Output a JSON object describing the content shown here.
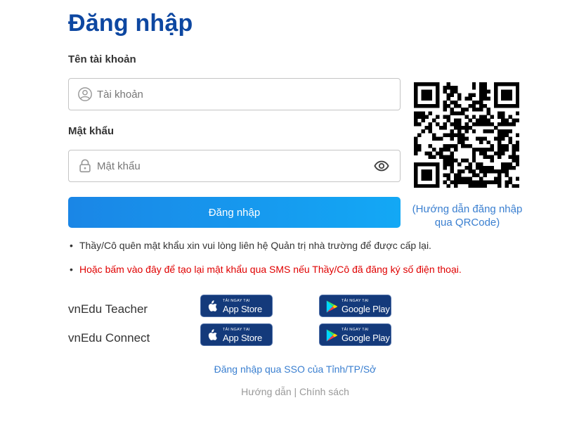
{
  "page": {
    "title": "Đăng nhập",
    "accent": "#0d47a1",
    "link_color": "#3a7fd0",
    "warning_color": "#e00000"
  },
  "form": {
    "username_label": "Tên tài khoản",
    "username_placeholder": "Tài khoản",
    "password_label": "Mật khẩu",
    "password_placeholder": "Mật khẩu",
    "submit_label": "Đăng nhập",
    "icons": [
      "user-icon",
      "lock-icon",
      "eye-icon"
    ]
  },
  "qr": {
    "help_text": "(Hướng dẫn đăng nhập qua QRCode)"
  },
  "notes": [
    "Thầy/Cô quên mật khẩu xin vui lòng liên hệ Quản trị nhà trường để được cấp lại.",
    "Hoặc bấm vào đây để tạo lại mật khẩu qua SMS nếu Thầy/Cô đã đăng ký số điện thoại."
  ],
  "apps": [
    {
      "name": "vnEdu Teacher"
    },
    {
      "name": "vnEdu Connect"
    }
  ],
  "badges": {
    "appstore_small": "TẢI NGAY TẠI",
    "appstore_big": "App Store",
    "googleplay_small": "TẢI NGAY TẠI",
    "googleplay_big": "Google Play"
  },
  "links": {
    "sso": "Đăng nhập qua SSO của Tỉnh/TP/Sở",
    "guide": "Hướng dẫn",
    "separator": "|",
    "policy": "Chính sách"
  }
}
